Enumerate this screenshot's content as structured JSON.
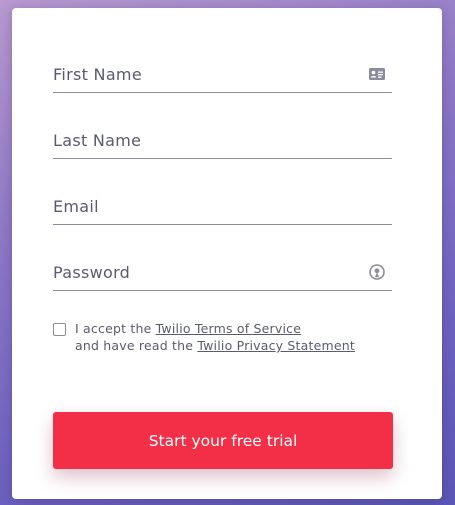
{
  "form": {
    "first_name": {
      "placeholder": "First Name",
      "value": "",
      "icon": "contact-card-icon"
    },
    "last_name": {
      "placeholder": "Last Name",
      "value": ""
    },
    "email": {
      "placeholder": "Email",
      "value": ""
    },
    "password": {
      "placeholder": "Password",
      "value": "",
      "icon": "password-reveal-icon"
    }
  },
  "terms": {
    "checked": false,
    "prefix": "I accept the ",
    "terms_link": "Twilio Terms of Service",
    "middle": "and have read the ",
    "privacy_link": "Twilio Privacy Statement"
  },
  "submit_label": "Start your free trial",
  "colors": {
    "accent": "#f22f46",
    "text": "#5a5a72",
    "underline": "#8c8c9c"
  }
}
